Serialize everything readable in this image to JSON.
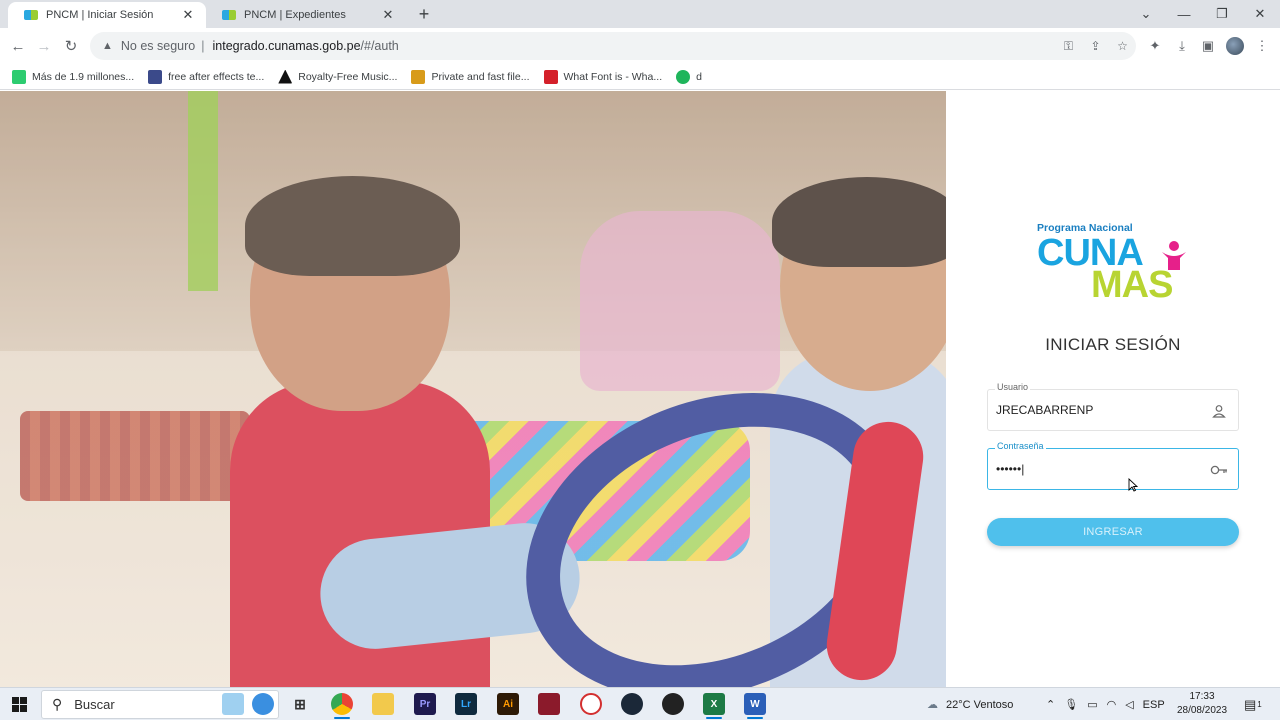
{
  "browser": {
    "tabs": [
      {
        "title": "PNCM | Iniciar Sesión",
        "active": true
      },
      {
        "title": "PNCM | Expedientes",
        "active": false
      }
    ],
    "new_tab_symbol": "+",
    "address": {
      "security_label": "No es seguro",
      "host": "integrado.cunamas.gob.pe",
      "path": "/#/auth"
    },
    "bookmarks": [
      {
        "label": "Más de 1.9 millones...",
        "icon": "pixabay-icon",
        "color": "#2dcc70"
      },
      {
        "label": "free after effects te...",
        "icon": "site-icon",
        "color": "#3b4a8a"
      },
      {
        "label": "Royalty-Free Music...",
        "icon": "warning-triangle-icon",
        "color": "#111111"
      },
      {
        "label": "Private and fast file...",
        "icon": "file-share-icon",
        "color": "#d89b1a"
      },
      {
        "label": "What Font is - Wha...",
        "icon": "font-icon",
        "color": "#d4202a"
      },
      {
        "label": "d",
        "icon": "green-badge-icon",
        "color": "#1fb55b"
      }
    ]
  },
  "login": {
    "logo": {
      "subtitle": "Programa Nacional",
      "line1": "CUNA",
      "line2": "MAS"
    },
    "heading": "INICIAR SESIÓN",
    "username": {
      "label": "Usuario",
      "value": "JRECABARRENP",
      "icon": "user-icon"
    },
    "password": {
      "label": "Contraseña",
      "value": "••••••|",
      "icon": "key-icon"
    },
    "submit_label": "INGRESAR"
  },
  "taskbar": {
    "search_placeholder": "Buscar",
    "weather": "22°C  Ventoso",
    "language": "ESP",
    "time": "17:33",
    "date": "28/08/2023",
    "notification_count": "1"
  },
  "colors": {
    "accent": "#3bb6e6",
    "button": "#4fc0ec",
    "logo_blue": "#1aa4e0",
    "logo_green": "#b8d432"
  }
}
